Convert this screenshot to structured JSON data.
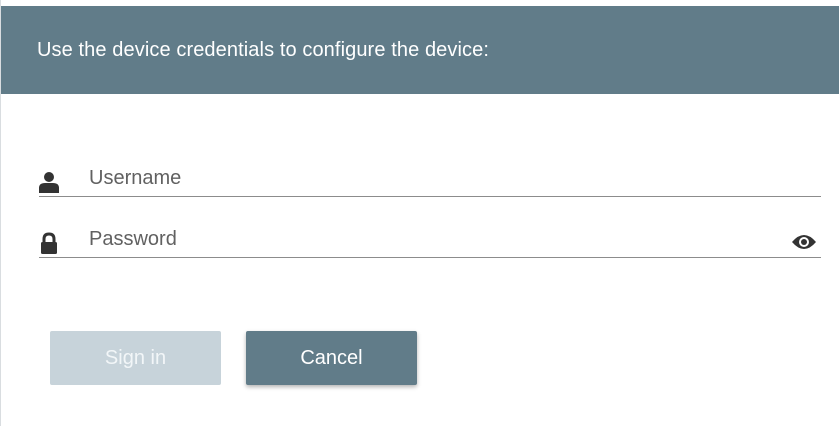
{
  "header": {
    "title": "Use the device credentials to configure the device:"
  },
  "form": {
    "username": {
      "icon": "user-icon",
      "value": "",
      "placeholder": "Username"
    },
    "password": {
      "icon": "lock-icon",
      "value": "",
      "placeholder": "Password",
      "toggle_icon": "eye-icon"
    }
  },
  "buttons": {
    "sign_in_label": "Sign in",
    "cancel_label": "Cancel"
  },
  "colors": {
    "header_background": "#617c89",
    "primary_button": "#617c89",
    "disabled_button": "#c7d3da",
    "icon_color": "#333333"
  }
}
